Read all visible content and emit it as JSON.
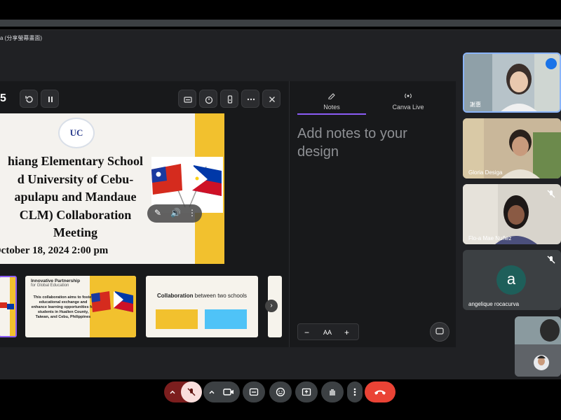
{
  "share_bar": {
    "text": "a (分享螢幕畫面)"
  },
  "presenter": {
    "slide_number": "5",
    "tools": [
      "history-icon",
      "pause-icon",
      "captions-icon",
      "timer-icon",
      "remote-icon",
      "more-icon",
      "close-icon"
    ]
  },
  "slide": {
    "logo_text": "UC",
    "title_lines": [
      "hiang Elementary School",
      "d University of Cebu-",
      "apulapu and Mandaue",
      "CLM) Collaboration",
      "Meeting"
    ],
    "date_line": "October 18, 2024 2:00 pm",
    "media_controls": [
      "pin-icon",
      "volume-icon",
      "more-icon"
    ]
  },
  "thumbnails": [
    {
      "label": "slide-1",
      "selected": true
    },
    {
      "label": "slide-2",
      "heading": "Innovative Partnership",
      "subheading": "for Global Education",
      "body": "This collaboration aims to foster educational exchange and enhance learning opportunities for students in Hualien County, Taiwan, and Cebu, Philippines"
    },
    {
      "label": "slide-3",
      "heading_bold": "Collaboration",
      "heading_rest": " between two schools"
    }
  ],
  "notes_panel": {
    "tabs": [
      {
        "label": "Notes",
        "active": true
      },
      {
        "label": "Canva Live",
        "active": false
      }
    ],
    "placeholder": "Add notes to your design",
    "zoom": {
      "minus": "−",
      "text": "AA",
      "plus": "+"
    }
  },
  "participants": [
    {
      "name": "謝惠",
      "speaking": true,
      "muted": false
    },
    {
      "name": "Gloria Desiga",
      "speaking": false,
      "muted": false
    },
    {
      "name": "Flo-a Mae Nuñez",
      "speaking": false,
      "muted": true
    },
    {
      "name": "angelique rocacurva",
      "avatar_letter": "a",
      "speaking": false,
      "muted": true
    }
  ],
  "controls": [
    "chevron-up-icon",
    "mic-off-icon",
    "camera-icon",
    "captions-icon",
    "emoji-icon",
    "present-icon",
    "raise-hand-icon",
    "more-icon",
    "end-call-icon"
  ],
  "colors": {
    "accent_purple": "#8b5cf6",
    "slide_yellow": "#f2c12e",
    "end_call_red": "#ea4335",
    "speaking_blue": "#8ab4f8"
  }
}
